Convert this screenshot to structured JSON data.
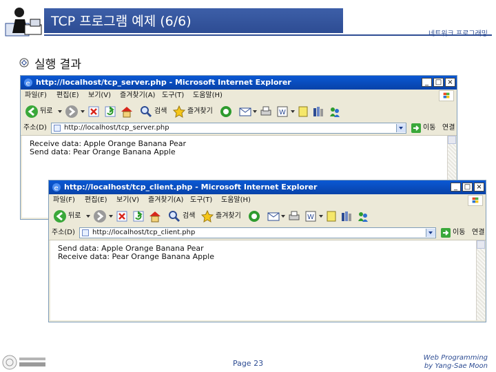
{
  "slide": {
    "title": "TCP 프로그램 예제 (6/6)",
    "subtitle_right": "네트워크 프로그래밍",
    "bullet": "실행 결과"
  },
  "windows": [
    {
      "title": "http://localhost/tcp_server.php - Microsoft Internet Explorer",
      "menus": [
        "파일(F)",
        "편집(E)",
        "보기(V)",
        "즐겨찾기(A)",
        "도구(T)",
        "도움말(H)"
      ],
      "toolbar": {
        "back": "뒤로",
        "search": "검색",
        "favorites": "즐겨찾기"
      },
      "address_label": "주소(D)",
      "address": "http://localhost/tcp_server.php",
      "go": "이동",
      "links": "연결",
      "content_lines": [
        "Receive data: Apple Orange Banana Pear",
        "Send data: Pear Orange Banana Apple"
      ]
    },
    {
      "title": "http://localhost/tcp_client.php - Microsoft Internet Explorer",
      "menus": [
        "파일(F)",
        "편집(E)",
        "보기(V)",
        "즐겨찾기(A)",
        "도구(T)",
        "도움말(H)"
      ],
      "toolbar": {
        "back": "뒤로",
        "search": "검색",
        "favorites": "즐겨찾기"
      },
      "address_label": "주소(D)",
      "address": "http://localhost/tcp_client.php",
      "go": "이동",
      "links": "연결",
      "content_lines": [
        "Send data: Apple Orange Banana Pear",
        "Receive data: Pear Orange Banana Apple"
      ]
    }
  ],
  "footer": {
    "page": "Page 23",
    "credit_line1": "Web Programming",
    "credit_line2": "by Yang-Sae Moon"
  },
  "colors": {
    "accent": "#2d4c93",
    "titlebar": "#0a58d4",
    "chrome": "#ece9d8"
  }
}
